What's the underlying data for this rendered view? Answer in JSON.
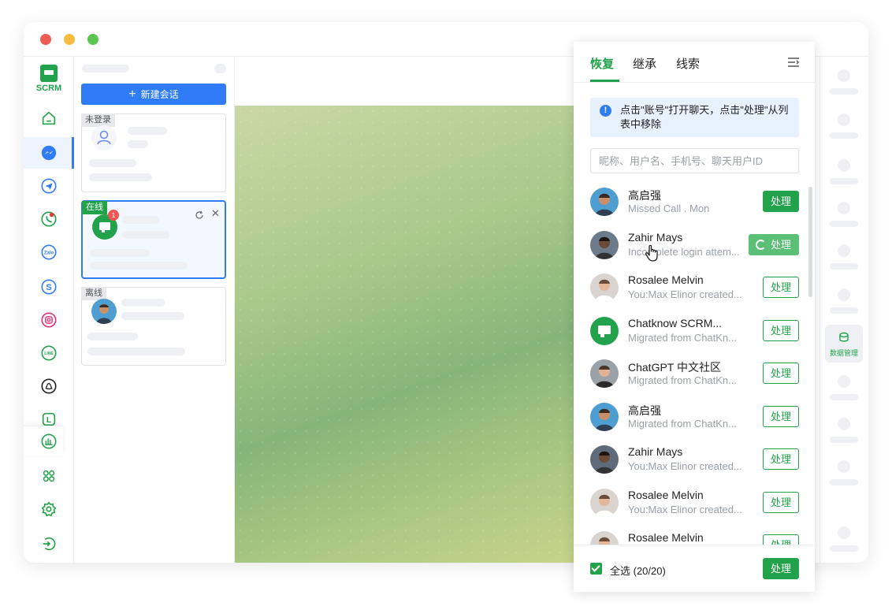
{
  "brand": {
    "name": "SCRM",
    "accent": "#22a34b",
    "primary": "#2f7cf6"
  },
  "window": {
    "controls": [
      "close",
      "minimize",
      "zoom"
    ]
  },
  "sidebar": {
    "items": [
      {
        "icon": "home-icon"
      },
      {
        "icon": "messenger-icon",
        "active": true
      },
      {
        "icon": "telegram-icon"
      },
      {
        "icon": "whatsapp-icon"
      },
      {
        "icon": "zalo-icon",
        "text": "Zalo"
      },
      {
        "icon": "skype-icon",
        "text": "S"
      },
      {
        "icon": "instagram-icon"
      },
      {
        "icon": "line-icon",
        "text": "LINE"
      },
      {
        "icon": "snapchat-icon"
      },
      {
        "icon": "l-icon",
        "text": "L"
      },
      {
        "icon": "analytics-icon"
      },
      {
        "icon": "apps-icon"
      },
      {
        "icon": "settings-icon"
      },
      {
        "icon": "logout-icon"
      }
    ]
  },
  "conversations": {
    "new_button": "新建会话",
    "cards": [
      {
        "status": "未登录"
      },
      {
        "status": "在线",
        "badge": "1"
      },
      {
        "status": "离线"
      }
    ]
  },
  "right_sidebar": {
    "data_management": "数据管理"
  },
  "panel": {
    "tabs": [
      {
        "label": "恢复",
        "active": true
      },
      {
        "label": "继承"
      },
      {
        "label": "线索"
      }
    ],
    "notice": {
      "icon": "!",
      "text": "点击\"账号\"打开聊天，点击\"处理\"从列表中移除"
    },
    "search": {
      "placeholder": "昵称、用户名、手机号、聊天用户ID",
      "value": ""
    },
    "items": [
      {
        "name": "高启强",
        "sub": "Missed Call . Mon",
        "action": "处理",
        "button_style": "solid"
      },
      {
        "name": "Zahir Mays",
        "sub": "Incomplete login attem...",
        "action": "处理",
        "button_style": "loading"
      },
      {
        "name": "Rosalee Melvin",
        "sub": "You:Max Elinor created...",
        "action": "处理",
        "button_style": "outline"
      },
      {
        "name": "Chatknow SCRM...",
        "sub": "Migrated from ChatKn...",
        "action": "处理",
        "button_style": "outline"
      },
      {
        "name": "ChatGPT 中文社区",
        "sub": "Migrated from ChatKn...",
        "action": "处理",
        "button_style": "outline"
      },
      {
        "name": "高启强",
        "sub": "Migrated from ChatKn...",
        "action": "处理",
        "button_style": "outline"
      },
      {
        "name": "Zahir Mays",
        "sub": "You:Max Elinor created...",
        "action": "处理",
        "button_style": "outline"
      },
      {
        "name": "Rosalee Melvin",
        "sub": "You:Max Elinor created...",
        "action": "处理",
        "button_style": "outline"
      },
      {
        "name": "Rosalee Melvin",
        "sub": "You:Max Elinor created...",
        "action": "处理",
        "button_style": "outline"
      }
    ],
    "footer": {
      "select_all": "全选 (20/20)",
      "checked": true,
      "action": "处理"
    }
  }
}
